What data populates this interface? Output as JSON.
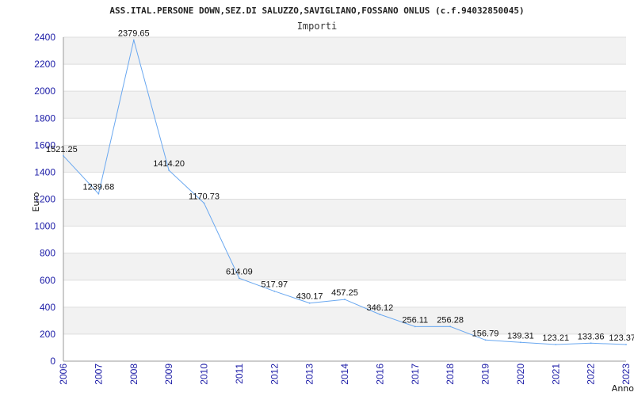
{
  "chart_data": {
    "type": "line",
    "title": "ASS.ITAL.PERSONE DOWN,SEZ.DI SALUZZO,SAVIGLIANO,FOSSANO ONLUS (c.f.94032850045)",
    "subtitle": "Importi",
    "xlabel": "Anno",
    "ylabel": "Euro",
    "ylim": [
      0,
      2400
    ],
    "yticks": [
      0,
      200,
      400,
      600,
      800,
      1000,
      1200,
      1400,
      1600,
      1800,
      2000,
      2200,
      2400
    ],
    "grid": "horizontal bands",
    "categories": [
      "2006",
      "2007",
      "2008",
      "2009",
      "2010",
      "2011",
      "2012",
      "2013",
      "2014",
      "2016",
      "2017",
      "2018",
      "2019",
      "2020",
      "2021",
      "2022",
      "2023"
    ],
    "values": [
      1521.25,
      1239.68,
      2379.65,
      1414.2,
      1170.73,
      614.09,
      517.97,
      430.17,
      457.25,
      346.12,
      256.11,
      256.28,
      156.79,
      139.31,
      123.21,
      133.36,
      123.37
    ],
    "labels": [
      "1521.25",
      "1239.68",
      "2379.65",
      "1414.20",
      "1170.73",
      "614.09",
      "517.97",
      "430.17",
      "457.25",
      "346.12",
      "256.11",
      "256.28",
      "156.79",
      "139.31",
      "123.21",
      "133.36",
      "123.37"
    ],
    "series_color": "#6aa8f0",
    "tick_color": "#1a1aa6",
    "band_color": "#f2f2f2"
  }
}
